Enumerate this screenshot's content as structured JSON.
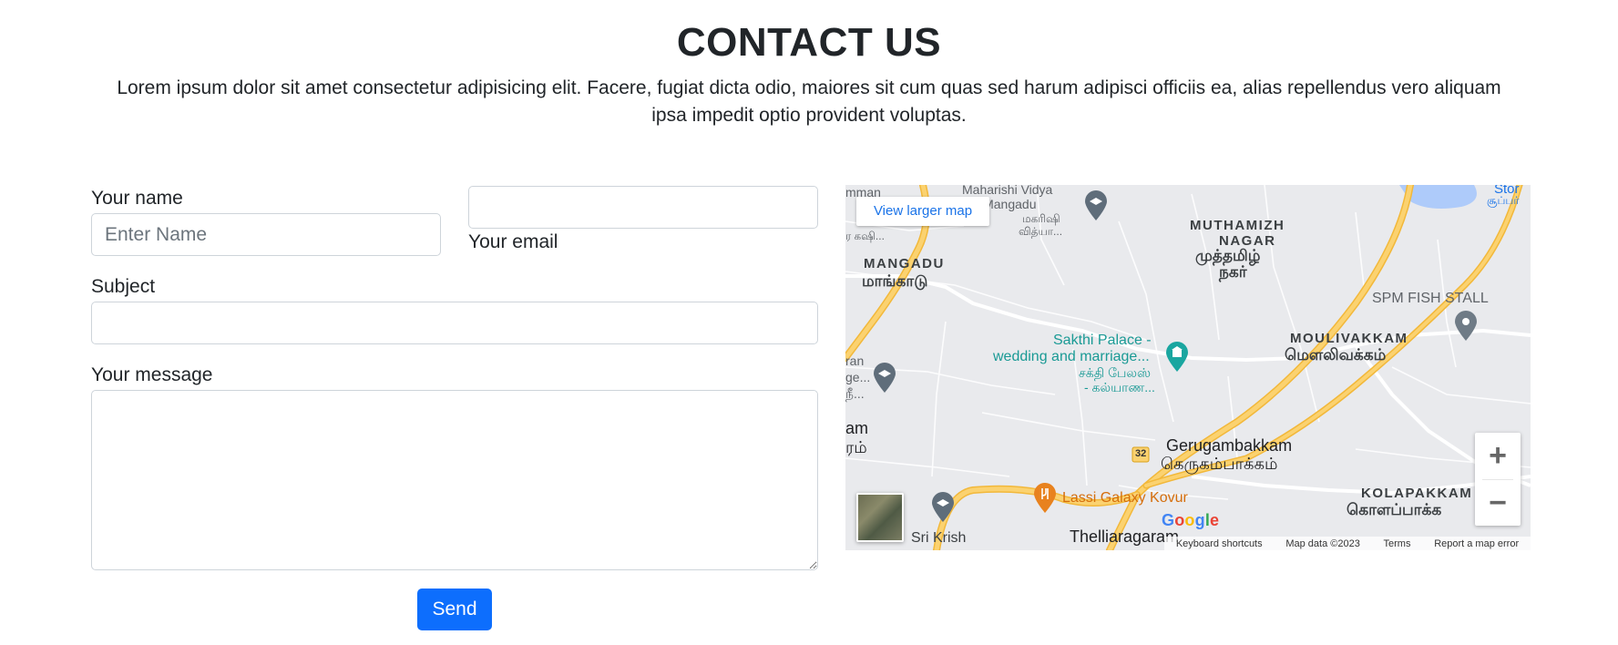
{
  "header": {
    "title": "CONTACT US",
    "subtitle": "Lorem ipsum dolor sit amet consectetur adipisicing elit. Facere, fugiat dicta odio, maiores sit cum quas sed harum adipisci officiis ea, alias repellendus vero aliquam ipsa impedit optio provident voluptas."
  },
  "form": {
    "name_label": "Your name",
    "name_placeholder": "Enter Name",
    "name_value": "",
    "email_label": "Your email",
    "email_value": "",
    "subject_label": "Subject",
    "subject_value": "",
    "message_label": "Your message",
    "message_value": "",
    "send_label": "Send"
  },
  "map": {
    "view_larger": "View larger map",
    "zoom_in": "+",
    "zoom_out": "−",
    "labels": {
      "mangadu": "MANGADU",
      "mangadu_ta": "மாங்காடு",
      "muthamizh": "MUTHAMIZH",
      "nagar": "NAGAR",
      "muthamizh_ta": "முத்தமிழ்",
      "nagar_ta": "நகர்",
      "moulivakkam": "MOULIVAKKAM",
      "moulivakkam_ta": "மௌலிவக்கம்",
      "spm_fish": "SPM FISH STALL",
      "sakthi_1": "Sakthi Palace -",
      "sakthi_2": "wedding and marriage...",
      "sakthi_ta_1": "சக்தி பேலஸ்",
      "sakthi_ta_2": "- கல்யாண...",
      "maharishi_1": "Maharishi Vidya",
      "maharishi_2": "r - Mangadu",
      "maharishi_ta_1": "மகரிஷி",
      "maharishi_ta_2": "வித்யா...",
      "gerugambakkam": "Gerugambakkam",
      "gerugambakkam_ta": "கெருகம்பாக்கம்",
      "kolapakkam": "KOLAPAKKAM",
      "kolapakkam_ta": "கொளப்பாக்க",
      "lassi": "Lassi Galaxy Kovur",
      "sri_krish": "Sri Krish",
      "thelliaragaram": "Thelliaragaram",
      "route_32": "32",
      "left_edge_1": "mman",
      "left_edge_2": "ran",
      "left_edge_3": "ge...",
      "left_edge_4": "நீ...",
      "left_edge_5": "am",
      "left_edge_6": "ரம்",
      "left_edge_7": "ர கஷி...",
      "stor": "Stor",
      "stor_ta": "சூப்பர்"
    },
    "attribution": {
      "keyboard": "Keyboard shortcuts",
      "data": "Map data ©2023",
      "terms": "Terms",
      "report": "Report a map error"
    },
    "colors": {
      "road_major": "#fbd270",
      "road_major_edge": "#f2b83a",
      "water": "#aecbfa",
      "land": "#e9eaed",
      "poi_teal": "#1a9a95",
      "poi_grey": "#5f6368",
      "poi_orange": "#e8821e"
    }
  }
}
